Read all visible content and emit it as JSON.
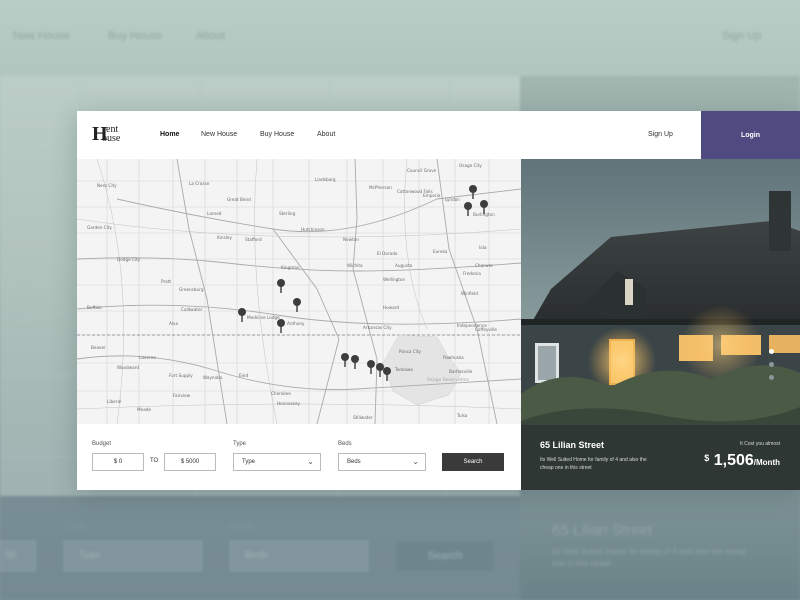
{
  "background": {
    "nav": [
      "New House",
      "Buy House",
      "About"
    ],
    "sign_up": "Sign Up",
    "type_label": "Type",
    "type_value": "Type",
    "beds_label": "Beds",
    "beds_value": "Beds",
    "budget_value": "00",
    "search_label": "Search",
    "listing_title": "65 Lilian Street",
    "listing_desc": "Its Well Suited Home for family of 4 and also the cheap one in this street"
  },
  "logo": {
    "initial": "H",
    "line1": "ent",
    "line2": "ouse"
  },
  "nav": {
    "home": "Home",
    "new_house": "New House",
    "buy_house": "Buy House",
    "about": "About",
    "sign_up": "Sign Up",
    "login": "Login"
  },
  "map": {
    "places": [
      "Council Grove",
      "Osage City",
      "Lindsborg",
      "La Crosse",
      "McPherson",
      "Cottonwood Falls",
      "Emporia",
      "Lyndon",
      "Burlington",
      "Ness City",
      "Great Bend",
      "Larned",
      "Sterling",
      "Hutchinson",
      "Newton",
      "Kinsley",
      "Stafford",
      "El Dorado",
      "Eureka",
      "Dodge City",
      "Pratt",
      "Kingman",
      "Wichita",
      "Augusta",
      "Greensburg",
      "Wellington",
      "Winfield",
      "Coldwater",
      "Medicine Lodge",
      "Anthony",
      "Arkansas City",
      "Independence",
      "Buffalo",
      "Alva",
      "Ponca City",
      "Pawhuska",
      "Bartlesville",
      "Woodward",
      "Enid",
      "Tonkawa",
      "Stillwater",
      "Tulsa",
      "Beaver",
      "Laverne",
      "Fort Supply",
      "Waynoka",
      "Fairview",
      "Cherokee",
      "Hennessey",
      "Chanute",
      "Iola",
      "Coffeyville",
      "Fredonia",
      "Osage Reservation",
      "Howard",
      "Garden City",
      "Liberal",
      "Meade"
    ],
    "pin_count": 12
  },
  "search": {
    "budget_label": "Budget",
    "budget_min": "$ 0",
    "to_label": "TO",
    "budget_max": "$ 5000",
    "type_label": "Type",
    "type_value": "Type",
    "beds_label": "Beds",
    "beds_value": "Beds",
    "button": "Search"
  },
  "listing": {
    "title": "65 Lilian Street",
    "description": "Its Well Suited Home for family of 4 and also the cheap one in this street",
    "price_note": "It Cost you almost",
    "currency": "$",
    "price": "1,506",
    "period": "/Month",
    "slides": 3,
    "active_slide": 1
  },
  "colors": {
    "accent": "#4f4a7f",
    "button_dark": "#3a3a3a",
    "background": "#a8bfb8"
  },
  "icons": {
    "select_arrow": "chevron-down-icon",
    "map_marker": "map-pin-icon"
  }
}
